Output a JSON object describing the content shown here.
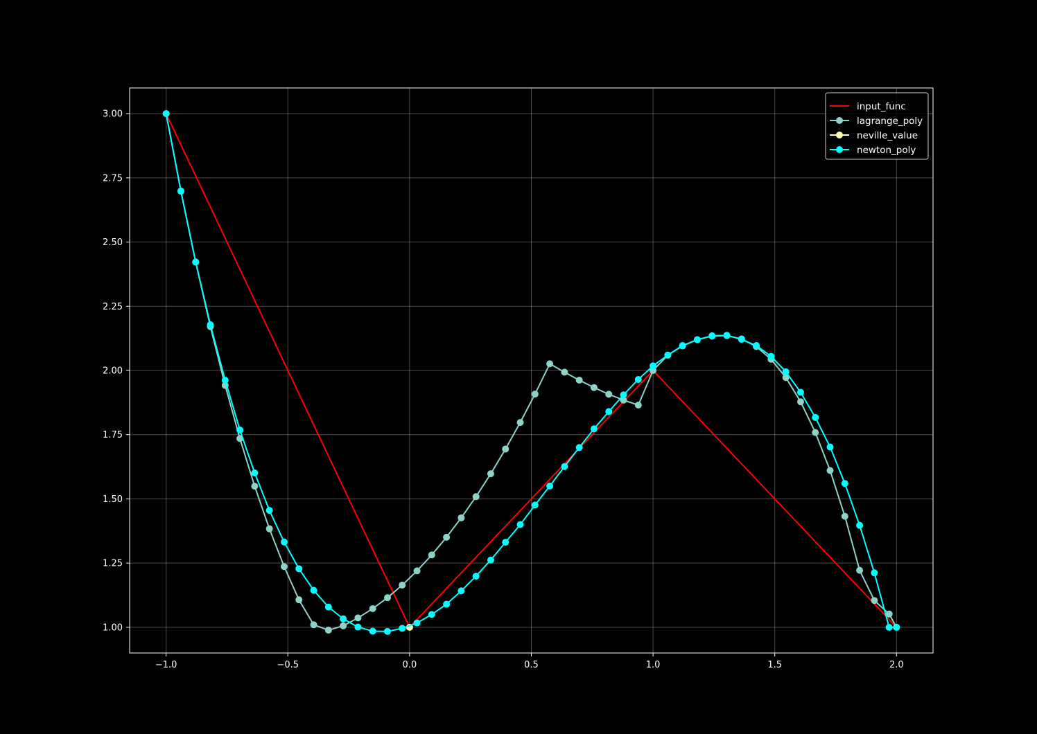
{
  "chart_data": {
    "type": "line",
    "title": "",
    "xlabel": "",
    "ylabel": "",
    "xlim": [
      -1.15,
      2.15
    ],
    "ylim": [
      0.9,
      3.1
    ],
    "grid": true,
    "legend_placement": "top-right",
    "background": "#000000",
    "x_ticks": [
      -1.0,
      -0.5,
      0.0,
      0.5,
      1.0,
      1.5,
      2.0
    ],
    "x_tick_labels": [
      "−1.0",
      "−0.5",
      "0.0",
      "0.5",
      "1.0",
      "1.5",
      "2.0"
    ],
    "y_ticks": [
      1.0,
      1.25,
      1.5,
      1.75,
      2.0,
      2.25,
      2.5,
      2.75,
      3.0
    ],
    "y_tick_labels": [
      "1.00",
      "1.25",
      "1.50",
      "1.75",
      "2.00",
      "2.25",
      "2.50",
      "2.75",
      "3.00"
    ],
    "series": [
      {
        "name": "input_func",
        "color": "#ff0000",
        "marker": false,
        "x": [
          -1.0,
          0.0,
          1.0,
          2.0
        ],
        "y": [
          3.0,
          1.0,
          2.0,
          1.0
        ]
      },
      {
        "name": "lagrange_poly",
        "color": "#8dd3c7",
        "marker": true,
        "x": [
          -1.0,
          -0.9394,
          -0.8788,
          -0.8182,
          -0.7576,
          -0.697,
          -0.6364,
          -0.5758,
          -0.5152,
          -0.4545,
          -0.3939,
          -0.3333,
          -0.2727,
          -0.2121,
          -0.1515,
          -0.0909,
          -0.0303,
          0.0303,
          0.0909,
          0.1515,
          0.2121,
          0.2727,
          0.3333,
          0.3939,
          0.4545,
          0.5152,
          0.5758,
          0.6364,
          0.697,
          0.7576,
          0.8182,
          0.8788,
          0.9394,
          1.0,
          1.0606,
          1.1212,
          1.1818,
          1.2424,
          1.303,
          1.3636,
          1.4242,
          1.4848,
          1.5455,
          1.6061,
          1.6667,
          1.7273,
          1.7879,
          1.8485,
          1.9091,
          1.9697,
          2.0
        ],
        "y": [
          3.0,
          2.6985,
          2.4224,
          2.1705,
          1.9418,
          1.7351,
          1.5494,
          1.3835,
          1.2364,
          1.1071,
          1.0099,
          0.9889,
          1.0058,
          1.0365,
          1.0727,
          1.1152,
          1.1642,
          1.2197,
          1.2818,
          1.3506,
          1.4262,
          1.5085,
          1.5978,
          1.6941,
          1.7975,
          1.9081,
          2.0259,
          1.9934,
          1.9623,
          1.9334,
          1.9073,
          1.8844,
          1.8652,
          2.0,
          2.0596,
          2.0956,
          2.1198,
          2.1336,
          2.1357,
          2.1228,
          2.0931,
          2.0434,
          1.9723,
          1.8781,
          1.7584,
          1.6104,
          1.4323,
          1.2218,
          1.1043,
          1.0516,
          1.0
        ],
        "hidden_under": "newton_poly"
      },
      {
        "name": "neville_value",
        "color": "#ffffb3",
        "marker": true,
        "x": [
          0.0
        ],
        "y": [
          1.0
        ]
      },
      {
        "name": "newton_poly",
        "color": "#00ffff",
        "marker": true,
        "x": [
          -1.0,
          -0.9394,
          -0.8788,
          -0.8182,
          -0.7576,
          -0.697,
          -0.6364,
          -0.5758,
          -0.5152,
          -0.4545,
          -0.3939,
          -0.3333,
          -0.2727,
          -0.2121,
          -0.1515,
          -0.0909,
          -0.0303,
          0.0303,
          0.0909,
          0.1515,
          0.2121,
          0.2727,
          0.3333,
          0.3939,
          0.4545,
          0.5152,
          0.5758,
          0.6364,
          0.697,
          0.7576,
          0.8182,
          0.8788,
          0.9394,
          1.0,
          1.0606,
          1.1212,
          1.1818,
          1.2424,
          1.303,
          1.3636,
          1.4242,
          1.4848,
          1.5455,
          1.6061,
          1.6667,
          1.7273,
          1.7879,
          1.8485,
          1.9091,
          1.9697,
          2.0
        ],
        "y": [
          3.0,
          2.698,
          2.422,
          2.178,
          1.962,
          1.768,
          1.601,
          1.455,
          1.332,
          1.228,
          1.144,
          1.079,
          1.033,
          1.001,
          0.985,
          0.984,
          0.996,
          1.017,
          1.05,
          1.09,
          1.142,
          1.199,
          1.262,
          1.331,
          1.4,
          1.476,
          1.55,
          1.626,
          1.7,
          1.773,
          1.84,
          1.905,
          1.965,
          2.018,
          2.06,
          2.097,
          2.12,
          2.135,
          2.137,
          2.121,
          2.097,
          2.055,
          1.995,
          1.915,
          1.817,
          1.702,
          1.56,
          1.397,
          1.212,
          1.0,
          1.0
        ]
      }
    ]
  }
}
